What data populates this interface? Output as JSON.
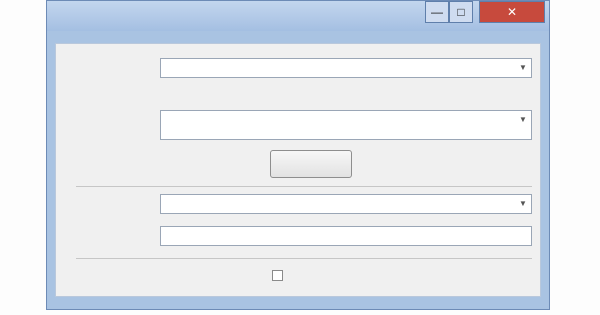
{
  "window": {
    "title": "",
    "controls": {
      "minimize_icon": "minimize-icon",
      "maximize_icon": "maximize-icon",
      "close_icon": "close-icon",
      "close_color": "#c74a3d"
    }
  },
  "form": {
    "row1": {
      "label": "",
      "value": ""
    },
    "row2": {
      "label": "",
      "value": ""
    },
    "row3": {
      "label": "",
      "value": ""
    },
    "action_button_label": "",
    "row4": {
      "label": "",
      "value": ""
    },
    "row5": {
      "label": "",
      "value": ""
    },
    "checkbox": {
      "label": "",
      "checked": false
    }
  },
  "colors": {
    "window_frame": "#a9c3e2",
    "client_background": "#f0f0f0"
  }
}
